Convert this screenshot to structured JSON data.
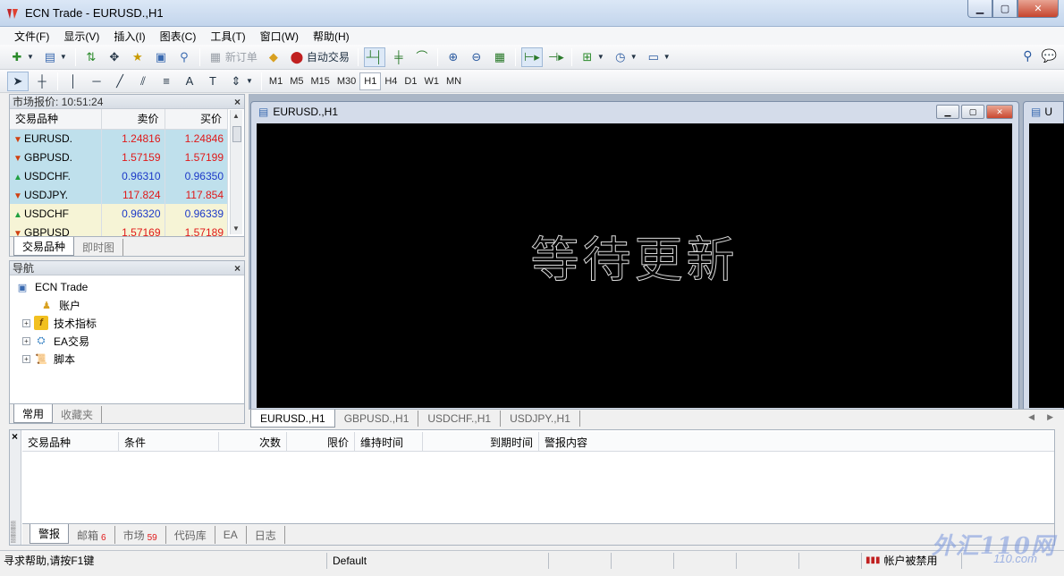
{
  "window": {
    "title": "ECN Trade - EURUSD.,H1"
  },
  "menu": [
    "文件(F)",
    "显示(V)",
    "插入(I)",
    "图表(C)",
    "工具(T)",
    "窗口(W)",
    "帮助(H)"
  ],
  "toolbar": {
    "new_order": "新订单",
    "auto_trade": "自动交易"
  },
  "periods": [
    "M1",
    "M5",
    "M15",
    "M30",
    "H1",
    "H4",
    "D1",
    "W1",
    "MN"
  ],
  "active_period": "H1",
  "market_watch": {
    "title": "市场报价: 10:51:24",
    "columns": [
      "交易品种",
      "卖价",
      "买价"
    ],
    "rows": [
      {
        "symbol": "EURUSD.",
        "bid": "1.24816",
        "ask": "1.24846",
        "dir": "down",
        "color": "red",
        "bg": "blue"
      },
      {
        "symbol": "GBPUSD.",
        "bid": "1.57159",
        "ask": "1.57199",
        "dir": "down",
        "color": "red",
        "bg": "blue"
      },
      {
        "symbol": "USDCHF.",
        "bid": "0.96310",
        "ask": "0.96350",
        "dir": "up",
        "color": "blu",
        "bg": "blue"
      },
      {
        "symbol": "USDJPY.",
        "bid": "117.824",
        "ask": "117.854",
        "dir": "down",
        "color": "red",
        "bg": "blue"
      },
      {
        "symbol": "USDCHF",
        "bid": "0.96320",
        "ask": "0.96339",
        "dir": "up",
        "color": "blu",
        "bg": "yellow"
      },
      {
        "symbol": "GBPUSD",
        "bid": "1.57169",
        "ask": "1.57189",
        "dir": "down",
        "color": "red",
        "bg": "yellow"
      }
    ],
    "tabs": [
      "交易品种",
      "即时图"
    ]
  },
  "navigator": {
    "title": "导航",
    "root": "ECN Trade",
    "items": [
      "账户",
      "技术指标",
      "EA交易",
      "脚本"
    ],
    "tabs": [
      "常用",
      "收藏夹"
    ]
  },
  "chart": {
    "window_title": "EURUSD.,H1",
    "second_window_title": "U",
    "waiting_text": "等待更新",
    "tabs": [
      "EURUSD.,H1",
      "GBPUSD.,H1",
      "USDCHF.,H1",
      "USDJPY.,H1"
    ]
  },
  "terminal": {
    "columns": [
      "交易品种",
      "条件",
      "次数",
      "限价",
      "维持时间",
      "到期时间",
      "警报内容"
    ],
    "tabs": [
      {
        "label": "警报",
        "badge": ""
      },
      {
        "label": "邮箱",
        "badge": "6"
      },
      {
        "label": "市场",
        "badge": "59"
      },
      {
        "label": "代码库",
        "badge": ""
      },
      {
        "label": "EA",
        "badge": ""
      },
      {
        "label": "日志",
        "badge": ""
      }
    ]
  },
  "status": {
    "help": "寻求帮助,请按F1键",
    "profile": "Default",
    "account": "帐户被禁用"
  },
  "watermark": {
    "brand": "外汇110网",
    "url": "110.com"
  }
}
